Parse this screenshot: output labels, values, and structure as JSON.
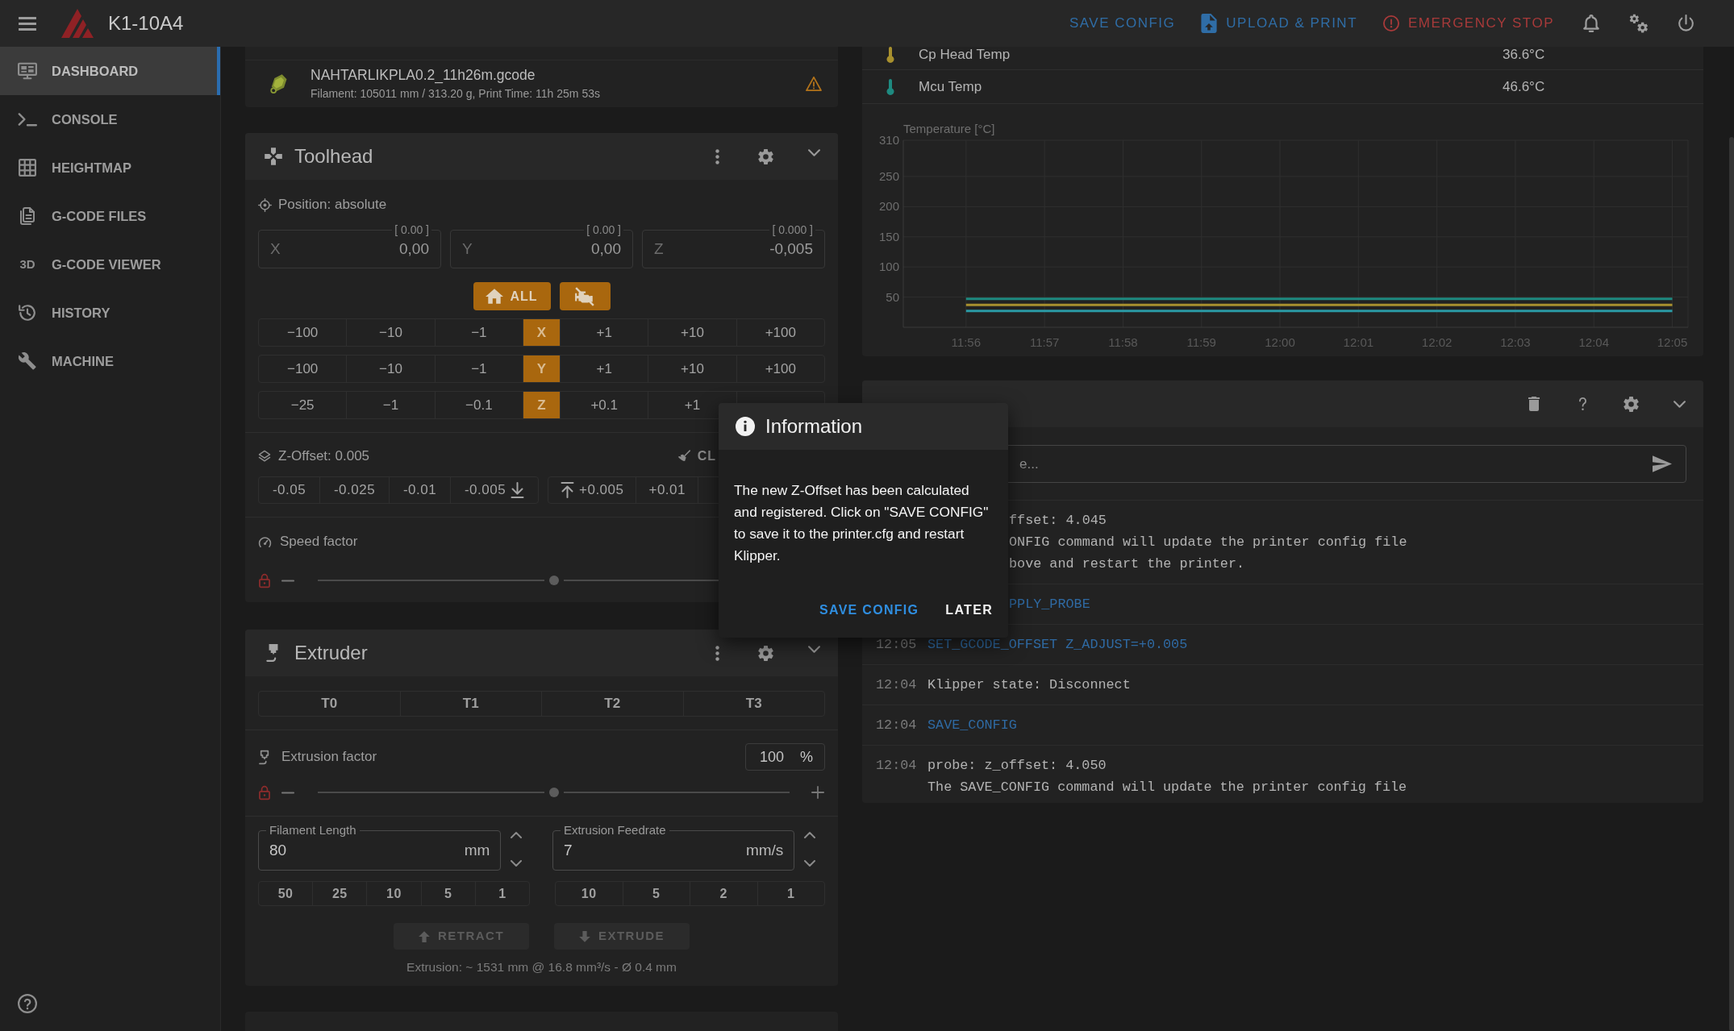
{
  "app_bar": {
    "title": "K1-10A4",
    "actions": [
      {
        "kind": "save",
        "label": "SAVE CONFIG"
      },
      {
        "kind": "upload",
        "label": "UPLOAD & PRINT"
      },
      {
        "kind": "stop",
        "label": "EMERGENCY STOP"
      }
    ]
  },
  "sidebar": {
    "items": [
      {
        "label": "DASHBOARD",
        "selected": true
      },
      {
        "label": "CONSOLE",
        "selected": false
      },
      {
        "label": "HEIGHTMAP",
        "selected": false
      },
      {
        "label": "G-CODE FILES",
        "selected": false
      },
      {
        "label": "G-CODE VIEWER",
        "glyph": "3D",
        "selected": false
      },
      {
        "label": "HISTORY",
        "selected": false
      },
      {
        "label": "MACHINE",
        "selected": false
      }
    ]
  },
  "file_list": {
    "rows": [
      {
        "filename": "NAHTARLIKPLA0.2_11h26m.gcode",
        "details": "Filament: 105011 mm / 313.20 g, Print Time: 11h 25m 53s",
        "warning": true
      }
    ]
  },
  "toolhead": {
    "title": "Toolhead",
    "position_label": "Position: absolute",
    "position_fields": [
      {
        "axis": "X",
        "value": "0,00",
        "hint": "[ 0.00 ]"
      },
      {
        "axis": "Y",
        "value": "0,00",
        "hint": "[ 0.00 ]"
      },
      {
        "axis": "Z",
        "value": "-0,005",
        "hint": "[ 0.000 ]"
      }
    ],
    "home_buttons": [
      {
        "kind": "home_all",
        "label": "ALL"
      },
      {
        "kind": "motors_off"
      }
    ],
    "jog_rows": [
      {
        "axis": "X",
        "minus": [
          "−100",
          "−10",
          "−1"
        ],
        "plus": [
          "+1",
          "+10",
          "+100"
        ]
      },
      {
        "axis": "Y",
        "minus": [
          "−100",
          "−10",
          "−1"
        ],
        "plus": [
          "+1",
          "+10",
          "+100"
        ]
      },
      {
        "axis": "Z",
        "minus": [
          "−25",
          "−1",
          "−0.1"
        ],
        "plus": [
          "+0.1",
          "+1"
        ]
      }
    ],
    "z_offset": {
      "label": "Z-Offset: 0.005",
      "clear_label": "CL",
      "down_steps": [
        "-0.05",
        "-0.025",
        "-0.01",
        "-0.005"
      ],
      "up_steps": [
        "+0.005",
        "+0.01"
      ]
    },
    "speed_factor": {
      "label": "Speed factor",
      "locked": true,
      "level": 0.5
    }
  },
  "extruder": {
    "title": "Extruder",
    "tools": [
      {
        "label": "T0",
        "selected": false
      },
      {
        "label": "T1",
        "selected": false
      },
      {
        "label": "T2",
        "selected": false
      },
      {
        "label": "T3",
        "selected": false
      }
    ],
    "extrusion_factor": {
      "label": "Extrusion factor",
      "value": "100",
      "unit": "%",
      "locked": true,
      "level": 0.5
    },
    "inputs": [
      {
        "label": "Filament Length",
        "value": "80",
        "unit": "mm",
        "presets": [
          "50",
          "25",
          "10",
          "5",
          "1"
        ]
      },
      {
        "label": "Extrusion Feedrate",
        "value": "7",
        "unit": "mm/s",
        "presets": [
          "10",
          "5",
          "2",
          "1"
        ]
      }
    ],
    "actions": [
      {
        "kind": "retract",
        "label": "RETRACT",
        "disabled": true
      },
      {
        "kind": "extrude",
        "label": "EXTRUDE",
        "disabled": true
      }
    ],
    "info": "Extrusion: ~ 1531 mm @ 16.8 mm³/s - Ø 0.4 mm"
  },
  "temperatures": {
    "sensors": [
      {
        "name": "Cp Head Temp",
        "value": "36.6°C",
        "color": "#a8902e"
      },
      {
        "name": "Mcu Temp",
        "value": "46.6°C",
        "color": "#1e8a80"
      }
    ],
    "chart_data": {
      "type": "line",
      "ylabel": "Temperature [°C]",
      "grid": true,
      "categories": [
        "11:56",
        "11:57",
        "11:58",
        "11:59",
        "12:00",
        "12:01",
        "12:02",
        "12:03",
        "12:04",
        "12:05"
      ],
      "ylim": [
        0,
        310
      ],
      "yticks": [
        50,
        100,
        150,
        200,
        250,
        310
      ],
      "series": [
        {
          "color": "#1e8a80",
          "values": [
            47,
            47,
            47,
            47,
            47,
            47,
            47,
            47,
            47,
            47
          ]
        },
        {
          "color": "#a8902e",
          "values": [
            37,
            37,
            37,
            37,
            37,
            37,
            37,
            37,
            37,
            37
          ]
        },
        {
          "color": "#2a9aa5",
          "values": [
            27,
            27,
            27,
            27,
            27,
            27,
            27,
            27,
            27,
            27
          ]
        }
      ]
    }
  },
  "console": {
    "input": {
      "placeholder": "e..."
    },
    "entries": [
      {
        "command": false,
        "text": "ffset: 4.045\nONFIG command will update the printer config file\nbove and restart the printer."
      },
      {
        "command": true,
        "text": "PPLY_PROBE"
      },
      {
        "time": "12:05",
        "command": true,
        "text": "SET_GCODE_OFFSET Z_ADJUST=+0.005"
      },
      {
        "time": "12:04",
        "command": false,
        "text": "Klipper state: Disconnect"
      },
      {
        "time": "12:04",
        "command": true,
        "text": "SAVE_CONFIG"
      },
      {
        "time": "12:04",
        "command": false,
        "text": "probe: z_offset: 4.050\nThe SAVE_CONFIG command will update the printer config file"
      }
    ]
  },
  "dialog": {
    "title": "Information",
    "message": "The new Z-Offset has been calculated\nand registered. Click on \"SAVE CONFIG\"\nto save it to the printer.cfg and restart\nKlipper.",
    "buttons": [
      {
        "kind": "primary",
        "label": "SAVE CONFIG"
      },
      {
        "kind": "plain",
        "label": "LATER"
      }
    ]
  }
}
